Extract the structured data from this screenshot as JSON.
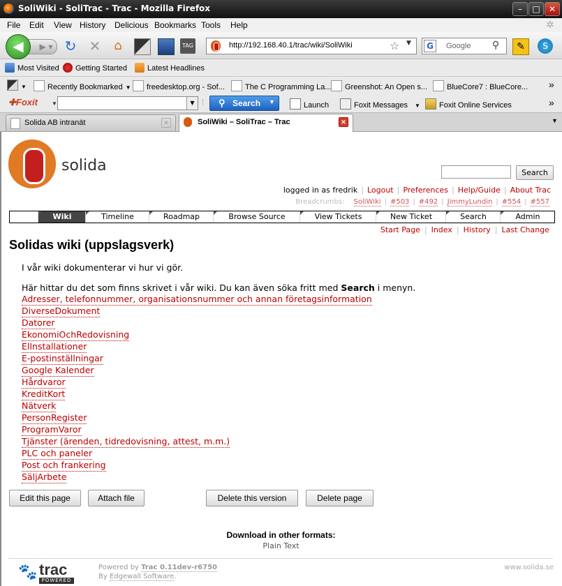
{
  "window": {
    "title": "SoliWiki - SoliTrac - Trac - Mozilla Firefox",
    "minimize": "–",
    "maximize": "□",
    "close": "✕"
  },
  "menu": [
    "File",
    "Edit",
    "View",
    "History",
    "Delicious",
    "Bookmarks",
    "Tools",
    "Help"
  ],
  "navbar": {
    "url": "http://192.168.40.1/trac/wiki/SoliWiki",
    "search_placeholder": "Google"
  },
  "bookmarks1": [
    "Most Visited",
    "Getting Started",
    "Latest Headlines"
  ],
  "bookmarks2": [
    "Recently Bookmarked",
    "freedesktop.org - Sof...",
    "The C Programming La...",
    "Greenshot: An Open s...",
    "BlueCore7 : BlueCore..."
  ],
  "foxit": {
    "logo": "Foxit",
    "search": "Search",
    "launch": "Launch",
    "messages": "Foxit Messages",
    "online": "Foxit Online Services"
  },
  "tabs": [
    {
      "label": "Solida AB intranät"
    },
    {
      "label": "SoliWiki – SoliTrac – Trac"
    }
  ],
  "site": {
    "logo_text": "solida",
    "search_button": "Search",
    "metanav": {
      "logged_in": "logged in as fredrik",
      "logout": "Logout",
      "preferences": "Preferences",
      "help": "Help/Guide",
      "about": "About Trac"
    },
    "breadcrumbs_label": "Breadcrumbs:",
    "breadcrumbs": [
      "SoliWiki",
      "#503",
      "#492",
      "JimmyLundin",
      "#554",
      "#557"
    ],
    "mainnav": [
      "Wiki",
      "Timeline",
      "Roadmap",
      "Browse Source",
      "View Tickets",
      "New Ticket",
      "Search",
      "Admin"
    ],
    "ctxtnav": [
      "Start Page",
      "Index",
      "History",
      "Last Change"
    ]
  },
  "page": {
    "title": "Solidas wiki (uppslagsverk)",
    "intro": "I vår wiki dokumenterar vi hur vi gör.",
    "para_before": "Här hittar du det som finns skrivet i vår wiki. Du kan även söka fritt med ",
    "para_bold": "Search",
    "para_after": " i menyn.",
    "links": [
      "Adresser, telefonnummer, organisationsnummer och annan företagsinformation",
      "DiverseDokument",
      "Datorer",
      "EkonomiOchRedovisning",
      "ElInstallationer",
      "E-postinställningar",
      "Google Kalender",
      "Hårdvaror",
      "KreditKort",
      "Nätverk",
      "PersonRegister",
      "ProgramVaror",
      "Tjänster (ärenden, tidredovisning, attest, m.m.)",
      "PLC och paneler",
      "Post och frankering",
      "SäljArbete"
    ],
    "buttons": {
      "edit": "Edit this page",
      "attach": "Attach file",
      "delete_version": "Delete this version",
      "delete_page": "Delete page"
    },
    "download_title": "Download in other formats:",
    "download_link": "Plain Text"
  },
  "footer": {
    "trac_word": "trac",
    "trac_powered": "POWERED",
    "powered_by": "Powered by ",
    "trac_version": "Trac 0.11dev-r6750",
    "by": "By ",
    "edgewall": "Edgewall Software",
    "period": ".",
    "site_url": "www.solida.se"
  }
}
